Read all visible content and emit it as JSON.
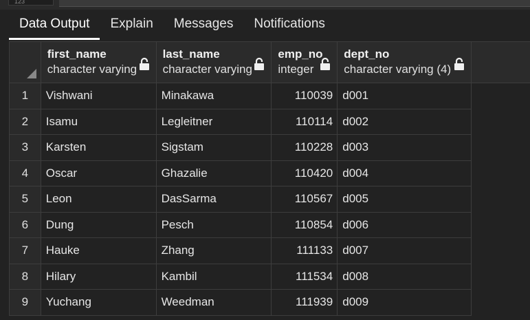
{
  "top_cell": "123",
  "tabs": [
    {
      "label": "Data Output",
      "active": true
    },
    {
      "label": "Explain",
      "active": false
    },
    {
      "label": "Messages",
      "active": false
    },
    {
      "label": "Notifications",
      "active": false
    }
  ],
  "columns": [
    {
      "name": "first_name",
      "type": "character varying",
      "locked": true
    },
    {
      "name": "last_name",
      "type": "character varying",
      "locked": true
    },
    {
      "name": "emp_no",
      "type": "integer",
      "locked": true
    },
    {
      "name": "dept_no",
      "type": "character varying (4)",
      "locked": true
    }
  ],
  "rows": [
    {
      "n": "1",
      "first_name": "Vishwani",
      "last_name": "Minakawa",
      "emp_no": "110039",
      "dept_no": "d001"
    },
    {
      "n": "2",
      "first_name": "Isamu",
      "last_name": "Legleitner",
      "emp_no": "110114",
      "dept_no": "d002"
    },
    {
      "n": "3",
      "first_name": "Karsten",
      "last_name": "Sigstam",
      "emp_no": "110228",
      "dept_no": "d003"
    },
    {
      "n": "4",
      "first_name": "Oscar",
      "last_name": "Ghazalie",
      "emp_no": "110420",
      "dept_no": "d004"
    },
    {
      "n": "5",
      "first_name": "Leon",
      "last_name": "DasSarma",
      "emp_no": "110567",
      "dept_no": "d005"
    },
    {
      "n": "6",
      "first_name": "Dung",
      "last_name": "Pesch",
      "emp_no": "110854",
      "dept_no": "d006"
    },
    {
      "n": "7",
      "first_name": "Hauke",
      "last_name": "Zhang",
      "emp_no": "111133",
      "dept_no": "d007"
    },
    {
      "n": "8",
      "first_name": "Hilary",
      "last_name": "Kambil",
      "emp_no": "111534",
      "dept_no": "d008"
    },
    {
      "n": "9",
      "first_name": "Yuchang",
      "last_name": "Weedman",
      "emp_no": "111939",
      "dept_no": "d009"
    }
  ],
  "colors": {
    "background": "#222222",
    "header": "#2b2b2b",
    "border": "#3d3d3d",
    "tab_indicator": "#ffffff"
  }
}
